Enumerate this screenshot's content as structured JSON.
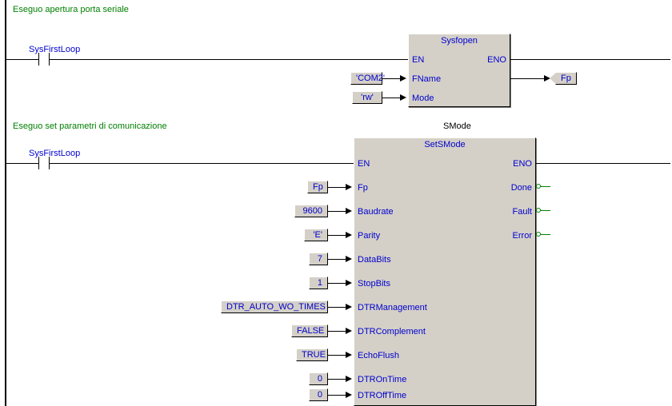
{
  "rung1": {
    "comment": "Eseguo apertura porta seriale",
    "contact": "SysFirstLoop",
    "block": {
      "title": "Sysfopen",
      "inputs": {
        "en": "EN",
        "fname": "FName",
        "mode": "Mode"
      },
      "outputs": {
        "eno": "ENO"
      },
      "params": {
        "fname": "'COM2'",
        "mode": "'rw'"
      },
      "outParam": "Fp"
    }
  },
  "rung2": {
    "comment": "Eseguo set parametri di comunicazione",
    "instance": "SMode",
    "contact": "SysFirstLoop",
    "block": {
      "title": "SetSMode",
      "inputs": {
        "en": "EN",
        "fp": "Fp",
        "baudrate": "Baudrate",
        "parity": "Parity",
        "databits": "DataBits",
        "stopbits": "StopBits",
        "dtrmgmt": "DTRManagement",
        "dtrcomp": "DTRComplement",
        "echoflush": "EchoFlush",
        "dtrontime": "DTROnTime",
        "dtrofftime": "DTROffTime"
      },
      "outputs": {
        "eno": "ENO",
        "done": "Done",
        "fault": "Fault",
        "error": "Error"
      },
      "params": {
        "fp": "Fp",
        "baudrate": "9600",
        "parity": "'E'",
        "databits": "7",
        "stopbits": "1",
        "dtrmgmt": "DTR_AUTO_WO_TIMES",
        "dtrcomp": "FALSE",
        "echoflush": "TRUE",
        "dtrontime": "0",
        "dtrofftime": "0"
      }
    }
  }
}
